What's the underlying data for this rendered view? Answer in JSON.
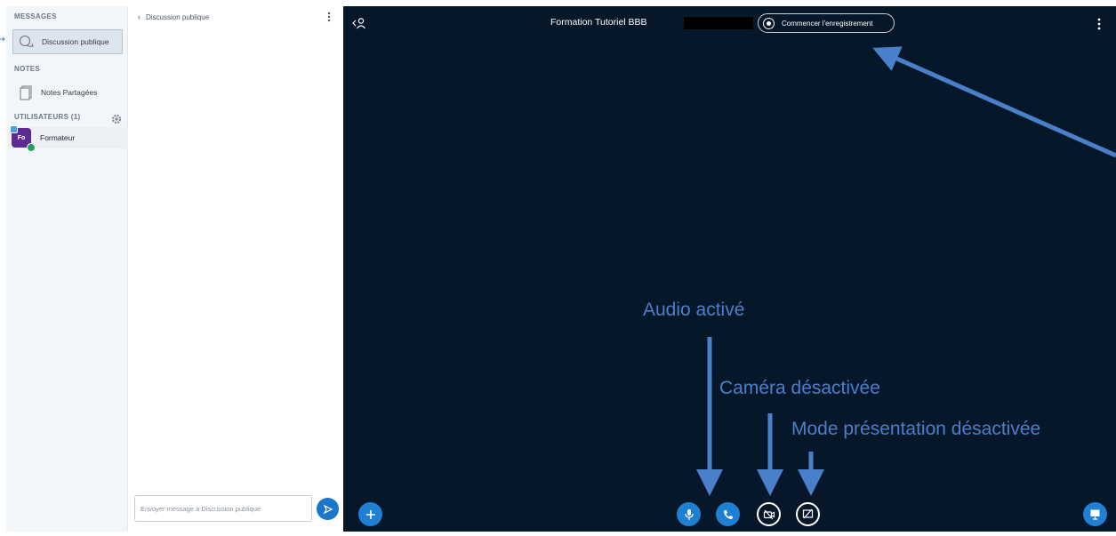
{
  "sidebar": {
    "messages_heading": "MESSAGES",
    "public_chat": "Discussion publique",
    "notes_heading": "NOTES",
    "shared_notes": "Notes Partagées",
    "users_heading": "UTILISATEURS (1)",
    "user": {
      "avatar_initials": "Fo",
      "name": "Formateur"
    }
  },
  "chat": {
    "back_label": "Discussion publique",
    "input_placeholder": "Envoyer message à Discussion publique"
  },
  "main": {
    "meeting_title": "Formation Tutoriel BBB",
    "record_label": "Commencer l'enregistrement"
  },
  "annotations": {
    "audio": "Audio activé",
    "camera": "Caméra désactivée",
    "presentation": "Mode présentation désactivée"
  },
  "colors": {
    "main_bg": "#06172a",
    "accent_blue": "#1f7fd3",
    "annotation_blue": "#4a7fc9",
    "sidebar_bg": "#f3f6f9",
    "user_online": "#23a05e"
  },
  "icons": {
    "public_chat": "chat-bubbles-icon",
    "notes": "document-icon",
    "settings": "gear-icon",
    "send": "send-icon",
    "users_toggle": "user-icon",
    "record": "record-icon",
    "options": "kebab-icon",
    "actions": "plus-icon",
    "audio": "microphone-icon",
    "phone": "phone-icon",
    "camera": "camera-off-icon",
    "screenshare": "screenshare-off-icon",
    "presentation": "presentation-icon"
  }
}
